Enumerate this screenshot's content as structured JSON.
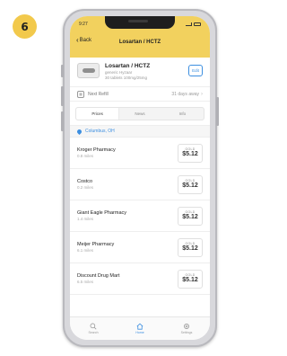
{
  "step_number": "6",
  "status_bar": {
    "time": "9:27"
  },
  "nav": {
    "back_label": "Back",
    "title": "Losartan / HCTZ"
  },
  "drug": {
    "name": "Losartan / HCTZ",
    "generic": "generic Hyzaar",
    "quantity": "30 tablets 100mg/25mg",
    "edit_label": "Edit"
  },
  "refill": {
    "label": "Next Refill",
    "value": "31 days away"
  },
  "tabs": [
    {
      "label": "Prices",
      "active": true
    },
    {
      "label": "News",
      "active": false
    },
    {
      "label": "Info",
      "active": false
    }
  ],
  "location": "Columbus, OH",
  "pharmacies": [
    {
      "name": "Kroger Pharmacy",
      "distance": "0.8 miles",
      "price_tag": "GOLD",
      "price": "$5.12"
    },
    {
      "name": "Costco",
      "distance": "0.2 miles",
      "price_tag": "GOLD",
      "price": "$5.12"
    },
    {
      "name": "Giant Eagle Pharmacy",
      "distance": "1.4 miles",
      "price_tag": "GOLD",
      "price": "$5.12"
    },
    {
      "name": "Meijer Pharmacy",
      "distance": "6.1 miles",
      "price_tag": "GOLD",
      "price": "$5.12"
    },
    {
      "name": "Discount Drug Mart",
      "distance": "6.5 miles",
      "price_tag": "GOLD",
      "price": "$5.12"
    }
  ],
  "bottom_tabs": [
    {
      "label": "Search",
      "icon": "search-icon",
      "active": false
    },
    {
      "label": "Home",
      "icon": "home-icon",
      "active": true
    },
    {
      "label": "Settings",
      "icon": "gear-icon",
      "active": false
    }
  ],
  "colors": {
    "accent_yellow": "#f2d15e",
    "link_blue": "#3d8fe0",
    "badge_yellow": "#f2c94c"
  }
}
